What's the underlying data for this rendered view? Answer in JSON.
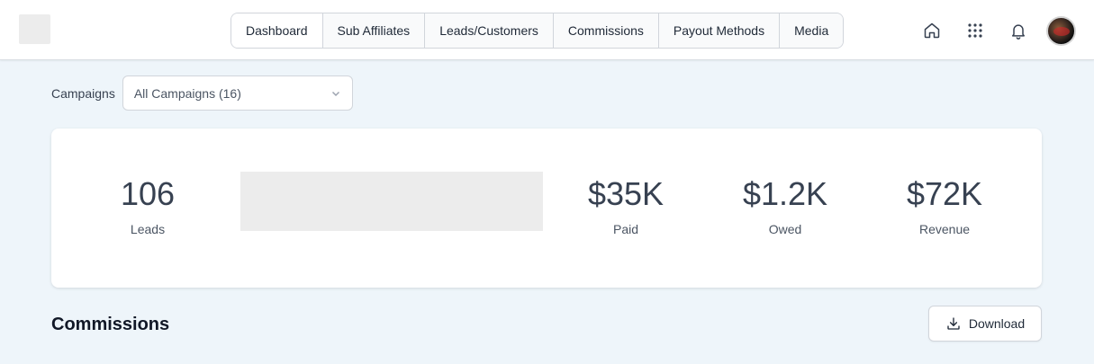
{
  "header": {
    "logo_icon": "logo-placeholder",
    "nav": [
      {
        "label": "Dashboard",
        "active": true
      },
      {
        "label": "Sub Affiliates",
        "active": false
      },
      {
        "label": "Leads/Customers",
        "active": false
      },
      {
        "label": "Commissions",
        "active": false
      },
      {
        "label": "Payout Methods",
        "active": false
      },
      {
        "label": "Media",
        "active": false
      }
    ],
    "icons": [
      "home-icon",
      "apps-grid-icon",
      "bell-icon"
    ],
    "avatar_icon": "user-avatar"
  },
  "filters": {
    "campaigns_label": "Campaigns",
    "campaigns_selected": "All Campaigns (16)"
  },
  "stats": [
    {
      "value": "106",
      "label": "Leads"
    },
    {
      "value": "$35K",
      "label": "Paid"
    },
    {
      "value": "$1.2K",
      "label": "Owed"
    },
    {
      "value": "$72K",
      "label": "Revenue"
    }
  ],
  "commissions": {
    "title": "Commissions",
    "download_label": "Download"
  },
  "colors": {
    "page_bg": "#eef5fa",
    "card_bg": "#ffffff",
    "text": "#374151"
  }
}
